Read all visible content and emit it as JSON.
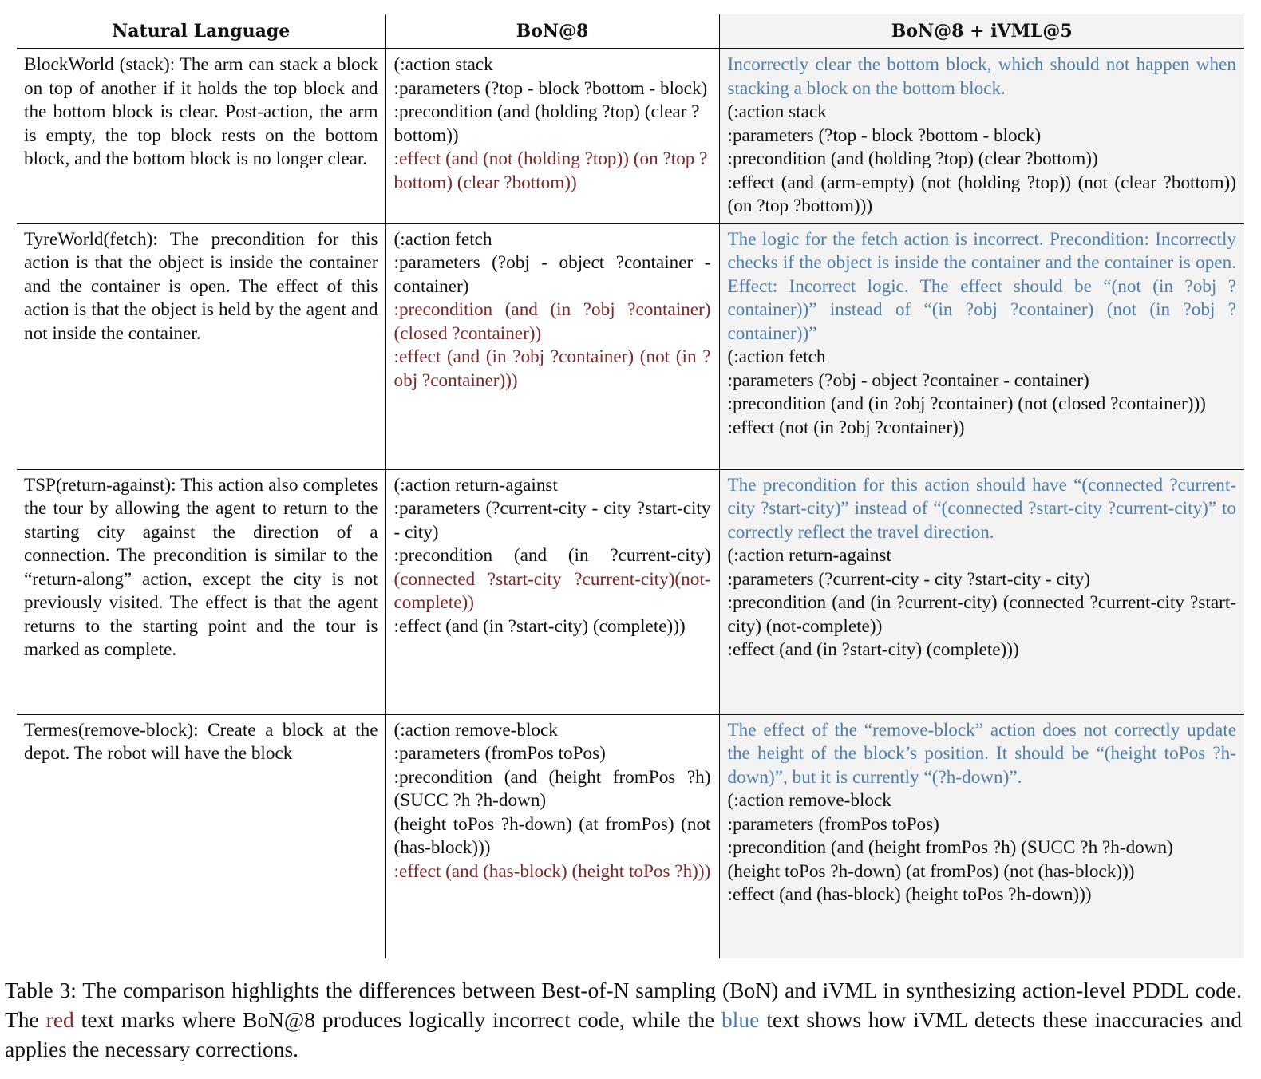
{
  "table": {
    "headers": [
      "Natural Language",
      "BoN@8",
      "BoN@8 + iVML@5"
    ],
    "rows": [
      {
        "natural_language": "BlockWorld (stack): The arm can stack a block on top of another if it holds the top block and the bottom block is clear. Post-action, the arm is empty, the top block rests on the bottom block, and the bottom block is no longer clear.",
        "bon": [
          {
            "text": "(:action stack",
            "error": false
          },
          {
            "text": ":parameters (?top - block ?bottom - block)",
            "error": false
          },
          {
            "text": ":precondition (and (holding ?top) (clear ?bottom))",
            "error": false
          },
          {
            "text": ":effect (and (not (holding ?top)) (on ?top ?bottom) (clear ?bottom))",
            "error": true
          }
        ],
        "ivml_note": "Incorrectly clear the bottom block, which should not happen when stacking a block on the bottom block.",
        "ivml_code": [
          "(:action stack",
          ":parameters (?top - block ?bottom - block)",
          ":precondition (and (holding ?top) (clear ?bottom))",
          ":effect (and (arm-empty) (not (holding ?top)) (not (clear ?bottom)) (on ?top ?bottom)))"
        ]
      },
      {
        "natural_language": "TyreWorld(fetch): The precondition for this action is that the object is inside the container and the container is open. The effect of this action is that the object is held by the agent and not inside the container.",
        "bon": [
          {
            "text": "(:action fetch",
            "error": false
          },
          {
            "text": ":parameters (?obj - object ?container - container)",
            "error": false
          },
          {
            "text": ":precondition (and (in ?obj ?container) (closed ?container))",
            "error": true
          },
          {
            "text": ":effect (and (in ?obj ?container) (not (in ?obj ?container)))",
            "error": true
          }
        ],
        "ivml_note": "The logic for the fetch action is incorrect. Precondition: Incorrectly checks if the object is inside the container and the container is open. Effect: Incorrect logic. The effect should be “(not (in ?obj ?container))” instead of “(in ?obj ?container) (not (in ?obj ?container))”",
        "ivml_code": [
          "(:action fetch",
          ":parameters (?obj - object ?container - container)",
          ":precondition (and (in ?obj ?container) (not (closed ?container)))",
          ":effect (not (in ?obj ?container))"
        ]
      },
      {
        "natural_language": "TSP(return-against): This action also completes the tour by allowing the agent to return to the starting city against the direction of a connection. The precondition is similar to the “return-along” action, except the city is not previously visited. The effect is that the agent returns to the starting point and the tour is marked as complete.",
        "bon": [
          {
            "text": "(:action return-against",
            "error": false
          },
          {
            "text": ":parameters (?current-city - city ?start-city - city)",
            "error": false
          },
          {
            "text": ":precondition (and (in ?current-city)",
            "error": false,
            "inline_next": true
          },
          {
            "text": " (connected ?start-city ?current-city)(not-complete))",
            "error": true
          },
          {
            "text": ":effect (and (in ?start-city) (complete)))",
            "error": false
          }
        ],
        "ivml_note": "The precondition for this action should have “(connected ?current-city ?start-city)” instead of “(connected ?start-city ?current-city)” to correctly reflect the travel direction.",
        "ivml_code": [
          "(:action return-against",
          ":parameters (?current-city - city ?start-city - city)",
          ":precondition (and (in ?current-city) (connected ?current-city ?start-city) (not-complete))",
          ":effect (and (in ?start-city) (complete)))"
        ]
      },
      {
        "natural_language": "Termes(remove-block): Create a block at the depot. The robot will have the block",
        "bon": [
          {
            "text": "(:action remove-block",
            "error": false
          },
          {
            "text": ":parameters (fromPos toPos)",
            "error": false
          },
          {
            "text": ":precondition (and (height fromPos ?h) (SUCC ?h ?h-down)",
            "error": false
          },
          {
            "text": "(height toPos ?h-down) (at fromPos) (not (has-block)))",
            "error": false
          },
          {
            "text": ":effect (and (has-block) (height toPos ?h)))",
            "error": true
          }
        ],
        "ivml_note": "The effect of the “remove-block” action does not correctly update the height of the block’s position. It should be “(height toPos ?h-down)”, but it is currently “(?h-down)”.",
        "ivml_code": [
          "(:action remove-block",
          ":parameters (fromPos toPos)",
          ":precondition (and (height fromPos ?h) (SUCC ?h ?h-down)",
          "(height toPos ?h-down) (at fromPos) (not (has-block)))",
          ":effect (and (has-block) (height toPos ?h-down)))"
        ]
      }
    ]
  },
  "caption": {
    "label": "Table 3:",
    "part1": " The comparison highlights the differences between Best-of-N sampling (BoN) and iVML in synthesizing action-level PDDL code. The ",
    "red_word": "red",
    "part2": " text marks where BoN@8 produces logically incorrect code, while the ",
    "blue_word": "blue",
    "part3": " text shows how iVML detects these inaccuracies and applies the necessary corrections."
  },
  "colors": {
    "error_red": "#7a2a2a",
    "correction_blue": "#4f7fab",
    "highlight_column_bg": "#f3f3f3"
  }
}
